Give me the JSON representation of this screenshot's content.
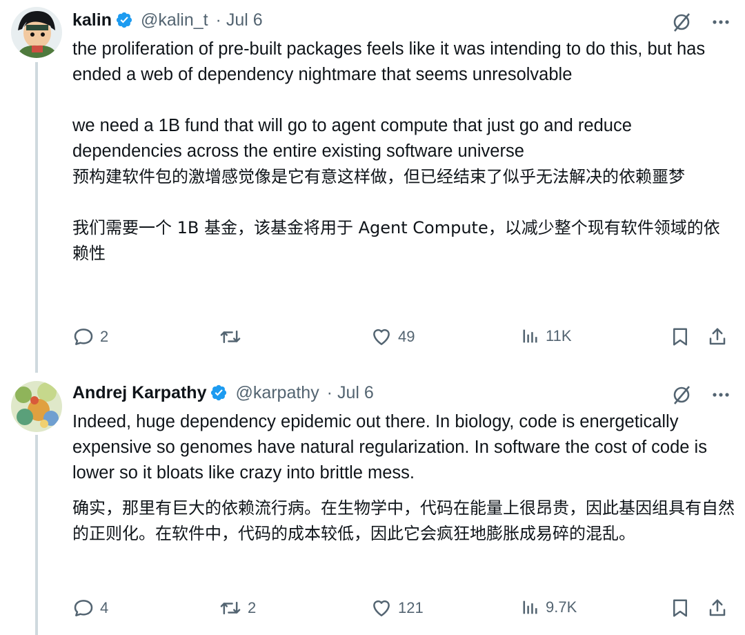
{
  "tweets": [
    {
      "name": "kalin",
      "handle": "@kalin_t",
      "sep": "·",
      "date": "Jul 6",
      "paragraphs": [
        "the proliferation of pre-built packages feels like it was intending to do this, but has ended a web of dependency nightmare that seems unresolvable",
        "we need a 1B fund that will go to agent compute that just go and reduce dependencies across the entire existing software universe",
        "预构建软件包的激增感觉像是它有意这样做，但已经结束了似乎无法解决的依赖噩梦",
        "我们需要一个 1B 基金，该基金将用于 Agent Compute，以减少整个现有软件领域的依赖性"
      ],
      "stats": {
        "replies": "2",
        "reposts": "",
        "likes": "49",
        "views": "11K"
      }
    },
    {
      "name": "Andrej Karpathy",
      "handle": "@karpathy",
      "sep": "·",
      "date": "Jul 6",
      "paragraphs": [
        "Indeed, huge dependency epidemic out there. In biology, code is energetically expensive so genomes have natural regularization. In software the cost of code is lower so it bloats like crazy into brittle mess.",
        "确实，那里有巨大的依赖流行病。在生物学中，代码在能量上很昂贵，因此基因组具有自然的正则化。在软件中，代码的成本较低，因此它会疯狂地膨胀成易碎的混乱。"
      ],
      "stats": {
        "replies": "4",
        "reposts": "2",
        "likes": "121",
        "views": "9.7K"
      }
    }
  ],
  "icons": {
    "verified": "verified-badge-icon",
    "grok": "grok-slash-icon",
    "more": "more-dots-icon",
    "reply": "reply-bubble-icon",
    "repost": "repost-arrows-icon",
    "like": "heart-icon",
    "views": "analytics-bars-icon",
    "bookmark": "bookmark-icon",
    "share": "share-upload-icon"
  },
  "colors": {
    "verified_blue": "#1d9bf0",
    "secondary_text": "#536471",
    "text": "#0f1419"
  }
}
